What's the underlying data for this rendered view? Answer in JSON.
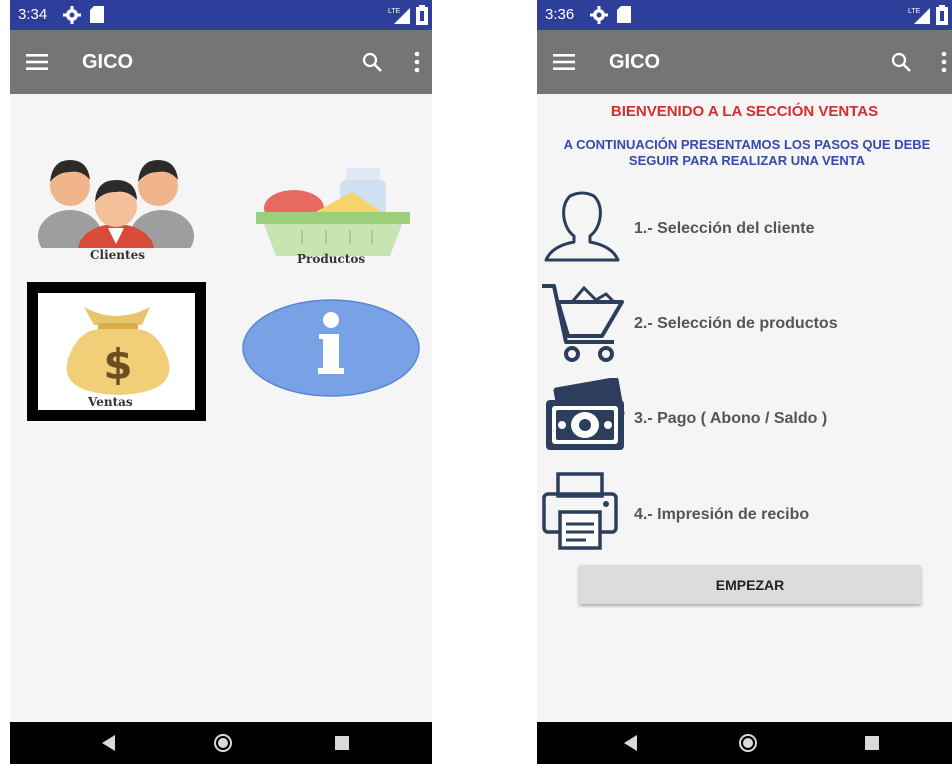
{
  "left": {
    "status": {
      "time": "3:34"
    },
    "toolbar": {
      "title": "GICO"
    },
    "grid": {
      "clientes_label": "Clientes",
      "productos_label": "Productos",
      "ventas_label": "Ventas",
      "info_label": "i"
    }
  },
  "right": {
    "status": {
      "time": "3:36"
    },
    "toolbar": {
      "title": "GICO"
    },
    "welcome": "BIENVENIDO A LA SECCIÓN VENTAS",
    "intro_line1": "A CONTINUACIÓN PRESENTAMOS LOS PASOS QUE DEBE",
    "intro_line2": "SEGUIR PARA REALIZAR UNA VENTA",
    "steps": [
      {
        "text": "1.- Selección del cliente",
        "icon": "user-outline-icon"
      },
      {
        "text": "2.- Selección de productos",
        "icon": "shopping-cart-icon"
      },
      {
        "text": "3.- Pago ( Abono / Saldo )",
        "icon": "money-icon"
      },
      {
        "text": "4.- Impresión de recibo",
        "icon": "printer-icon"
      }
    ],
    "start_button": "EMPEZAR"
  },
  "colors": {
    "statusbar": "#2d3f9a",
    "toolbar": "#757575",
    "welcome_red": "#d32f2f",
    "intro_blue": "#3949ab",
    "icon_navy": "#2c3e5b"
  }
}
